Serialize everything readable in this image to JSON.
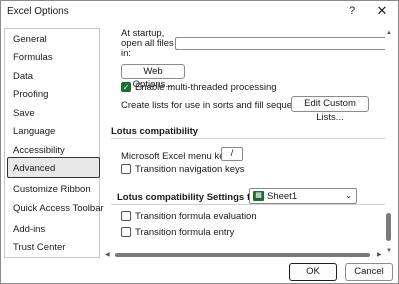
{
  "window": {
    "title": "Excel Options",
    "help_glyph": "?",
    "close_glyph": "✕"
  },
  "sidebar": {
    "items": [
      {
        "label": "General"
      },
      {
        "label": "Formulas"
      },
      {
        "label": "Data"
      },
      {
        "label": "Proofing"
      },
      {
        "label": "Save"
      },
      {
        "label": "Language"
      },
      {
        "label": "Accessibility"
      },
      {
        "label": "Advanced",
        "selected": true
      },
      {
        "label": "Customize Ribbon"
      },
      {
        "label": "Quick Access Toolbar"
      },
      {
        "label": "Add-ins"
      },
      {
        "label": "Trust Center"
      }
    ]
  },
  "general": {
    "startup_label_line1": "At startup,",
    "startup_label_line2": "open all files",
    "startup_label_line3": "in:",
    "startup_value": "",
    "web_options_button": "Web Options...",
    "multithread_label": "Enable multi-threaded processing",
    "multithread_checked": true,
    "custom_lists_label": "Create lists for use in sorts and fill sequences:",
    "edit_custom_lists_button": "Edit Custom Lists..."
  },
  "lotus": {
    "header": "Lotus compatibility",
    "menu_key_label": "Microsoft Excel menu key:",
    "menu_key_value": "/",
    "transition_nav_label": "Transition navigation keys",
    "transition_nav_checked": false
  },
  "lotus_settings": {
    "header": "Lotus compatibility Settings for:",
    "sheet_value": "Sheet1",
    "formula_eval_label": "Transition formula evaluation",
    "formula_eval_checked": false,
    "formula_entry_label": "Transition formula entry",
    "formula_entry_checked": false
  },
  "footer": {
    "ok_label": "OK",
    "cancel_label": "Cancel"
  },
  "colors": {
    "accent_green": "#1e6b37",
    "selected_bg": "#e8e8e8"
  }
}
